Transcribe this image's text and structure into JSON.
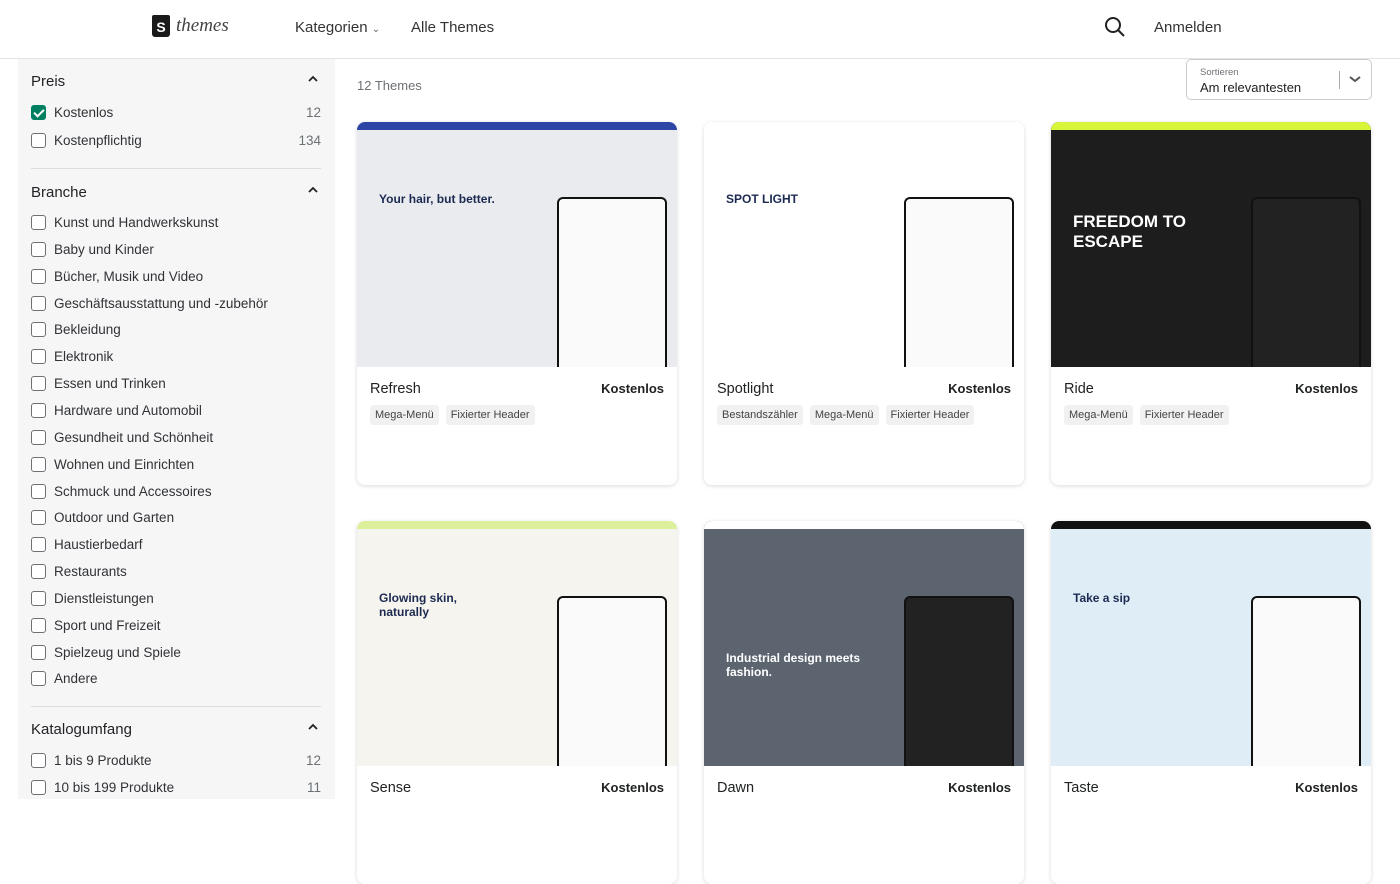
{
  "header": {
    "logo_text": "themes",
    "nav": [
      {
        "label": "Kategorien"
      },
      {
        "label": "Alle Themes"
      }
    ],
    "login": "Anmelden"
  },
  "sidebar": {
    "price": {
      "title": "Preis",
      "items": [
        {
          "label": "Kostenlos",
          "count": "12",
          "checked": true
        },
        {
          "label": "Kostenpflichtig",
          "count": "134",
          "checked": false
        }
      ]
    },
    "industry": {
      "title": "Branche",
      "items": [
        "Kunst und Handwerkskunst",
        "Baby und Kinder",
        "Bücher, Musik und Video",
        "Geschäftsausstattung und -zubehör",
        "Bekleidung",
        "Elektronik",
        "Essen und Trinken",
        "Hardware und Automobil",
        "Gesundheit und Schönheit",
        "Wohnen und Einrichten",
        "Schmuck und Accessoires",
        "Outdoor und Garten",
        "Haustierbedarf",
        "Restaurants",
        "Dienstleistungen",
        "Sport und Freizeit",
        "Spielzeug und Spiele",
        "Andere"
      ]
    },
    "catalog": {
      "title": "Katalogumfang",
      "items": [
        {
          "label": "1 bis 9 Produkte",
          "count": "12"
        },
        {
          "label": "10 bis 199 Produkte",
          "count": "11"
        }
      ]
    }
  },
  "main": {
    "count_label": "12 Themes",
    "sort": {
      "label": "Sortieren",
      "value": "Am relevantesten"
    },
    "themes": [
      {
        "name": "Refresh",
        "price": "Kostenlos",
        "tags": [
          "Mega-Menü",
          "Fixierter Header"
        ],
        "preview_text": "Your hair, but better.",
        "bg": "#e9ebee",
        "bar": "#2d46a5"
      },
      {
        "name": "Spotlight",
        "price": "Kostenlos",
        "tags": [
          "Bestandszähler",
          "Mega-Menü",
          "Fixierter Header"
        ],
        "preview_text": "SPOT LIGHT",
        "bg": "#ffffff",
        "bar": "#ffffff"
      },
      {
        "name": "Ride",
        "price": "Kostenlos",
        "tags": [
          "Mega-Menü",
          "Fixierter Header"
        ],
        "preview_text": "FREEDOM TO ESCAPE",
        "bg": "#1d1d1d",
        "bar": "#d8f53a"
      },
      {
        "name": "Sense",
        "price": "Kostenlos",
        "tags": [],
        "preview_text": "Glowing skin, naturally",
        "bg": "#f6f4ee",
        "bar": "#dcef9a"
      },
      {
        "name": "Dawn",
        "price": "Kostenlos",
        "tags": [],
        "preview_text": "Industrial design meets fashion.",
        "bg": "#5c6470",
        "bar": "#ffffff"
      },
      {
        "name": "Taste",
        "price": "Kostenlos",
        "tags": [],
        "preview_text": "Take a sip",
        "bg": "#dfeef6",
        "bar": "#111111"
      }
    ]
  }
}
